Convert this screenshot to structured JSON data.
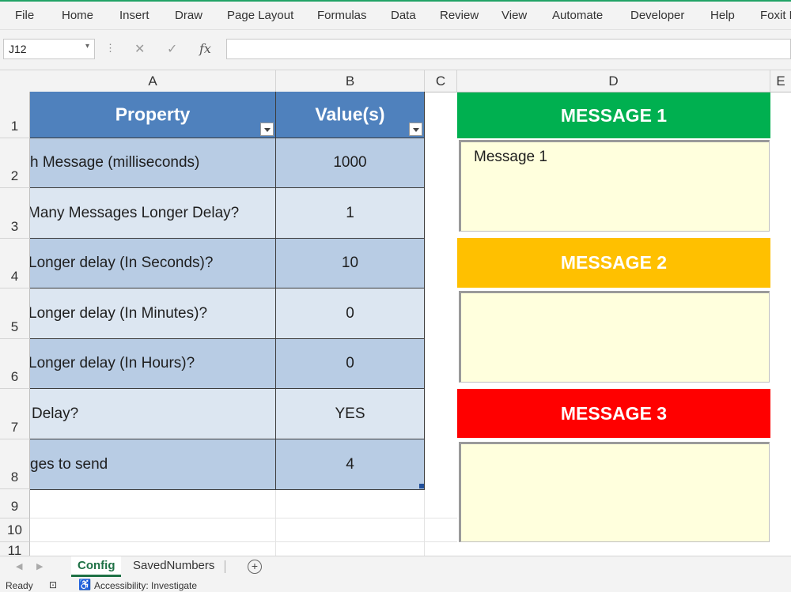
{
  "ribbon": {
    "tabs": [
      "File",
      "Home",
      "Insert",
      "Draw",
      "Page Layout",
      "Formulas",
      "Data",
      "Review",
      "View",
      "Automate",
      "Developer",
      "Help",
      "Foxit P"
    ]
  },
  "formula_bar": {
    "name_box": "J12",
    "cancel_icon": "✕",
    "enter_icon": "✓",
    "fx_label": "fx",
    "formula": ""
  },
  "columns": [
    "A",
    "B",
    "C",
    "D",
    "E"
  ],
  "rows": [
    "1",
    "2",
    "3",
    "4",
    "5",
    "6",
    "7",
    "8",
    "9",
    "10",
    "11"
  ],
  "table": {
    "headers": [
      "Property",
      "Value(s)"
    ],
    "rows": [
      {
        "property": "h Message (milliseconds)",
        "value": "1000"
      },
      {
        "property": "Many Messages Longer Delay?",
        "value": "1"
      },
      {
        "property": "Longer delay (In Seconds)?",
        "value": "10"
      },
      {
        "property": "Longer delay (In Minutes)?",
        "value": "0"
      },
      {
        "property": "Longer delay (In Hours)?",
        "value": "0"
      },
      {
        "property": "Delay?",
        "value": "YES"
      },
      {
        "property": "ges to send",
        "value": "4"
      }
    ]
  },
  "messages": [
    {
      "title": "MESSAGE 1",
      "color": "#00b050",
      "text": "Message 1"
    },
    {
      "title": "MESSAGE 2",
      "color": "#ffc000",
      "text": ""
    },
    {
      "title": "MESSAGE 3",
      "color": "#ff0000",
      "text": ""
    }
  ],
  "sheets": {
    "tabs": [
      "Config",
      "SavedNumbers"
    ],
    "active": "Config",
    "add_label": "+"
  },
  "status_bar": {
    "ready": "Ready",
    "accessibility": "Accessibility: Investigate"
  },
  "colors": {
    "table_header": "#4f81bd",
    "row_dark": "#b8cce4",
    "row_light": "#dce6f1",
    "message_box": "#ffffdd",
    "accent": "#1e7145"
  }
}
